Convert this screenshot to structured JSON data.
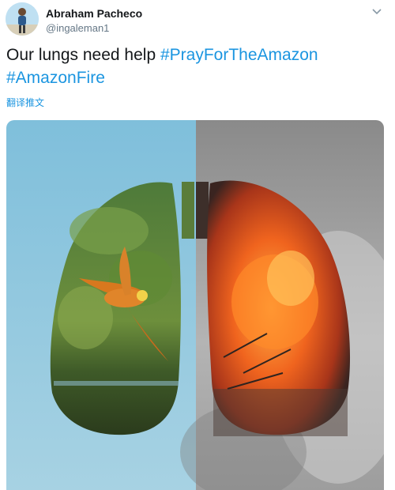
{
  "tweet": {
    "author_name": "Abraham Pacheco",
    "author_handle": "@ingaleman1",
    "text": "Our lungs need help",
    "hashtags": [
      "#PrayForTheAmazon",
      "#AmazonFire"
    ],
    "translate_label": "翻译推文",
    "menu_icon": "chevron-down-icon",
    "avatar_icon": "avatar"
  },
  "colors": {
    "hashtag": "#1b95e0",
    "text": "#14171a",
    "handle": "#657786",
    "sky": "#8fc3dc",
    "smoke": "#9a9a9a",
    "fire": "#f0641e"
  }
}
